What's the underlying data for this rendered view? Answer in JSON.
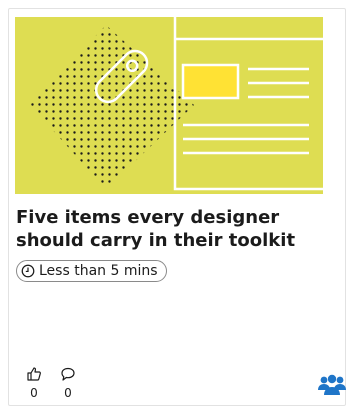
{
  "card": {
    "title": "Five items every designer should carry in their toolkit",
    "duration": "Less than 5 mins",
    "icons": {
      "duration": "clock-icon",
      "likes": "thumbs-up-icon",
      "comments": "comment-icon",
      "audience": "people-group-icon"
    },
    "likes": "0",
    "comments": "0",
    "colors": {
      "hero_bg": "#dedd52",
      "hero_accent": "#ffe234",
      "text": "#1b1b1b",
      "audience_icon": "#1f75c8"
    }
  }
}
